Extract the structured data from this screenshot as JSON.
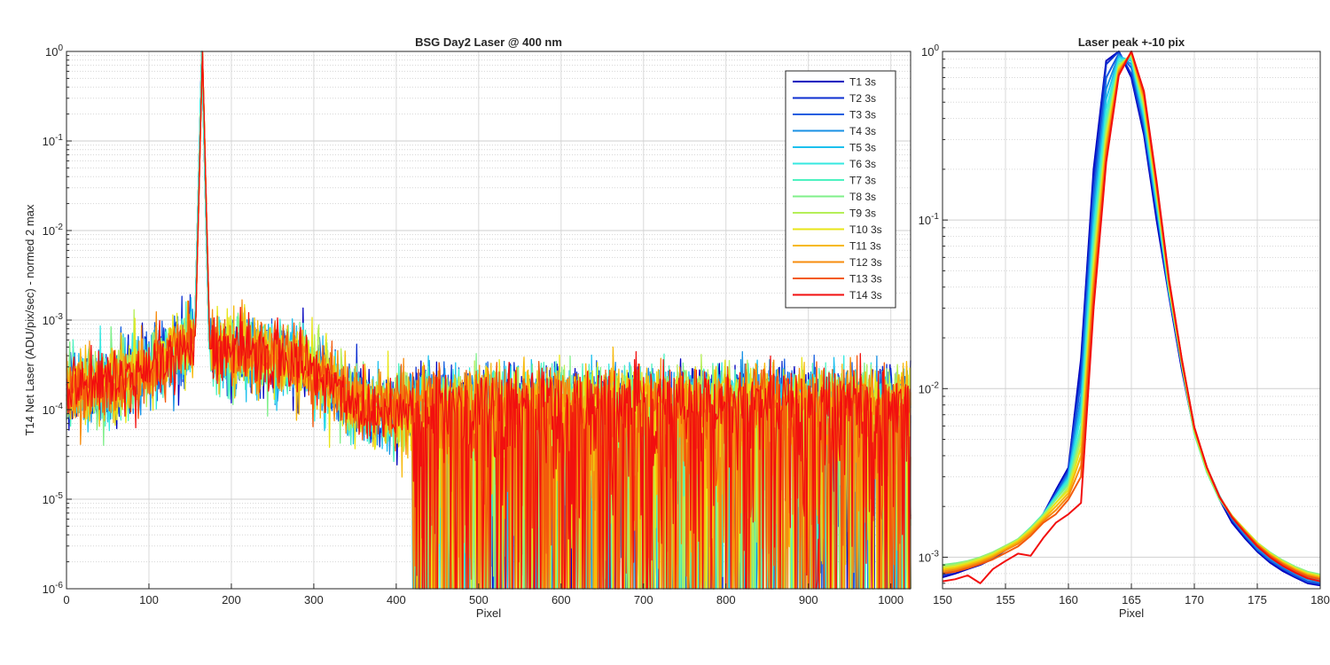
{
  "chart_data": [
    {
      "type": "line",
      "title": "BSG  Day2 Laser @ 400 nm",
      "xlabel": "Pixel",
      "ylabel": "T14 Net Laser (ADU/pix/sec) - normed 2 max",
      "yscale": "log",
      "xlim": [
        0,
        1024
      ],
      "ylim": [
        1e-06,
        1
      ],
      "xticks": [
        0,
        100,
        200,
        300,
        400,
        500,
        600,
        700,
        800,
        900,
        1000
      ],
      "yticks": [
        1e-06,
        1e-05,
        0.0001,
        0.001,
        0.01,
        0.1,
        1
      ],
      "grid": true,
      "legend_position": "top-right",
      "peak_pixel": 165,
      "spike": {
        "series": "T11 3s",
        "x": 663,
        "y": 0.0005
      },
      "series": [
        {
          "name": "T1 3s",
          "color": "#0000bf",
          "peak_x": 164
        },
        {
          "name": "T2 3s",
          "color": "#0c2fd0",
          "peak_x": 164
        },
        {
          "name": "T3 3s",
          "color": "#165ee0",
          "peak_x": 164
        },
        {
          "name": "T4 3s",
          "color": "#1891e4",
          "peak_x": 164
        },
        {
          "name": "T5 3s",
          "color": "#1cc0ee",
          "peak_x": 164
        },
        {
          "name": "T6 3s",
          "color": "#35e8e0",
          "peak_x": 164
        },
        {
          "name": "T7 3s",
          "color": "#4df2c0",
          "peak_x": 164
        },
        {
          "name": "T8 3s",
          "color": "#7ff08a",
          "peak_x": 165
        },
        {
          "name": "T9 3s",
          "color": "#b5ef58",
          "peak_x": 165
        },
        {
          "name": "T10 3s",
          "color": "#e8e618",
          "peak_x": 165
        },
        {
          "name": "T11 3s",
          "color": "#f7b90a",
          "peak_x": 165
        },
        {
          "name": "T12 3s",
          "color": "#f78c0e",
          "peak_x": 165
        },
        {
          "name": "T13 3s",
          "color": "#f35a0c",
          "peak_x": 165
        },
        {
          "name": "T14 3s",
          "color": "#f20f0f",
          "peak_x": 165
        }
      ]
    },
    {
      "type": "line",
      "title": "Laser peak +-10 pix",
      "xlabel": "Pixel",
      "ylabel": "",
      "yscale": "log",
      "xlim": [
        150,
        180
      ],
      "ylim": [
        0.00065,
        1
      ],
      "xticks": [
        150,
        155,
        160,
        165,
        170,
        175,
        180
      ],
      "yticks": [
        0.001,
        0.01,
        0.1,
        1
      ],
      "grid": true,
      "x": [
        150,
        151,
        152,
        153,
        154,
        155,
        156,
        157,
        158,
        159,
        160,
        161,
        162,
        163,
        164,
        165,
        166,
        167,
        168,
        169,
        170,
        171,
        172,
        173,
        174,
        175,
        176,
        177,
        178,
        179,
        180
      ],
      "series": [
        {
          "name": "T1 3s",
          "values": [
            0.00076,
            0.0008,
            0.00085,
            0.0009,
            0.00098,
            0.0011,
            0.00122,
            0.00145,
            0.0018,
            0.0025,
            0.0034,
            0.015,
            0.2,
            0.88,
            1.0,
            0.7,
            0.32,
            0.1,
            0.035,
            0.013,
            0.0055,
            0.0033,
            0.0022,
            0.0016,
            0.0013,
            0.00108,
            0.00093,
            0.00083,
            0.00076,
            0.0007,
            0.00068
          ]
        },
        {
          "name": "T2 3s",
          "values": [
            0.00078,
            0.00082,
            0.00086,
            0.00091,
            0.00099,
            0.00111,
            0.00123,
            0.00146,
            0.0018,
            0.0024,
            0.0033,
            0.013,
            0.17,
            0.84,
            1.0,
            0.73,
            0.34,
            0.11,
            0.036,
            0.014,
            0.0057,
            0.0034,
            0.0023,
            0.00165,
            0.00133,
            0.0011,
            0.00095,
            0.00085,
            0.00077,
            0.00071,
            0.00069
          ]
        },
        {
          "name": "T3 3s",
          "values": [
            0.0008,
            0.00083,
            0.00087,
            0.00092,
            0.001,
            0.00112,
            0.00124,
            0.00147,
            0.0018,
            0.0024,
            0.0032,
            0.011,
            0.14,
            0.7,
            0.97,
            0.8,
            0.36,
            0.115,
            0.037,
            0.0145,
            0.0058,
            0.0034,
            0.0023,
            0.00168,
            0.00135,
            0.00111,
            0.00096,
            0.00086,
            0.00078,
            0.00072,
            0.0007
          ]
        },
        {
          "name": "T4 3s",
          "values": [
            0.00082,
            0.00085,
            0.00088,
            0.00093,
            0.00101,
            0.00113,
            0.00125,
            0.00148,
            0.0018,
            0.0023,
            0.0031,
            0.009,
            0.12,
            0.6,
            0.95,
            0.84,
            0.38,
            0.12,
            0.037,
            0.0145,
            0.0058,
            0.0034,
            0.0023,
            0.0017,
            0.00137,
            0.00113,
            0.00098,
            0.00088,
            0.0008,
            0.00074,
            0.00071
          ]
        },
        {
          "name": "T5 3s",
          "values": [
            0.00084,
            0.00087,
            0.0009,
            0.00095,
            0.00103,
            0.00114,
            0.00126,
            0.00149,
            0.0018,
            0.0023,
            0.003,
            0.008,
            0.1,
            0.52,
            0.93,
            0.88,
            0.4,
            0.125,
            0.037,
            0.0142,
            0.0056,
            0.0033,
            0.0023,
            0.00172,
            0.0014,
            0.00116,
            0.00101,
            0.0009,
            0.00082,
            0.00076,
            0.00073
          ]
        },
        {
          "name": "T6 3s",
          "values": [
            0.00086,
            0.00089,
            0.00092,
            0.00097,
            0.00105,
            0.00115,
            0.00127,
            0.0015,
            0.0018,
            0.0023,
            0.0029,
            0.007,
            0.085,
            0.45,
            0.9,
            0.9,
            0.42,
            0.13,
            0.038,
            0.014,
            0.0055,
            0.0032,
            0.0022,
            0.00172,
            0.00142,
            0.00118,
            0.00103,
            0.00092,
            0.00084,
            0.00078,
            0.00075
          ]
        },
        {
          "name": "T7 3s",
          "values": [
            0.00088,
            0.0009,
            0.00093,
            0.00098,
            0.00106,
            0.00116,
            0.00128,
            0.0015,
            0.0018,
            0.0022,
            0.0028,
            0.006,
            0.075,
            0.4,
            0.87,
            0.92,
            0.44,
            0.135,
            0.038,
            0.0138,
            0.0054,
            0.0032,
            0.0022,
            0.00173,
            0.00144,
            0.0012,
            0.00105,
            0.00094,
            0.00086,
            0.0008,
            0.00077
          ]
        },
        {
          "name": "T8 3s",
          "values": [
            0.0009,
            0.00092,
            0.00095,
            0.001,
            0.00107,
            0.00117,
            0.00128,
            0.00149,
            0.00178,
            0.0022,
            0.0027,
            0.0055,
            0.065,
            0.36,
            0.84,
            0.94,
            0.46,
            0.14,
            0.039,
            0.014,
            0.0055,
            0.0032,
            0.0022,
            0.00175,
            0.00146,
            0.00122,
            0.00107,
            0.00096,
            0.00088,
            0.00082,
            0.00079
          ]
        },
        {
          "name": "T9 3s",
          "values": [
            0.00088,
            0.0009,
            0.00094,
            0.00099,
            0.00106,
            0.00116,
            0.00127,
            0.00147,
            0.00175,
            0.0021,
            0.0026,
            0.005,
            0.058,
            0.33,
            0.82,
            0.96,
            0.48,
            0.145,
            0.04,
            0.0142,
            0.0056,
            0.0033,
            0.00225,
            0.00176,
            0.00146,
            0.00122,
            0.00106,
            0.00095,
            0.00087,
            0.00081,
            0.00078
          ]
        },
        {
          "name": "T10 3s",
          "values": [
            0.00086,
            0.00088,
            0.00092,
            0.00097,
            0.00104,
            0.00114,
            0.00125,
            0.00145,
            0.00172,
            0.0021,
            0.0025,
            0.0045,
            0.05,
            0.3,
            0.8,
            0.97,
            0.5,
            0.15,
            0.041,
            0.0145,
            0.0057,
            0.0033,
            0.00226,
            0.00175,
            0.00145,
            0.00121,
            0.00105,
            0.00094,
            0.00086,
            0.0008,
            0.00077
          ]
        },
        {
          "name": "T11 3s",
          "values": [
            0.00084,
            0.00086,
            0.0009,
            0.00095,
            0.00102,
            0.00112,
            0.00123,
            0.00142,
            0.00168,
            0.002,
            0.0024,
            0.004,
            0.045,
            0.28,
            0.78,
            0.98,
            0.52,
            0.155,
            0.042,
            0.0148,
            0.0058,
            0.0034,
            0.00228,
            0.00175,
            0.00144,
            0.0012,
            0.00104,
            0.00093,
            0.00085,
            0.00079,
            0.00076
          ]
        },
        {
          "name": "T12 3s",
          "values": [
            0.00082,
            0.00084,
            0.00088,
            0.00093,
            0.001,
            0.0011,
            0.0012,
            0.00138,
            0.00164,
            0.0019,
            0.0023,
            0.0035,
            0.04,
            0.26,
            0.76,
            0.99,
            0.54,
            0.16,
            0.042,
            0.0148,
            0.0058,
            0.0034,
            0.00228,
            0.00174,
            0.00143,
            0.00119,
            0.00103,
            0.00092,
            0.00084,
            0.00078,
            0.00075
          ]
        },
        {
          "name": "T13 3s",
          "values": [
            0.0008,
            0.00082,
            0.00086,
            0.00091,
            0.00097,
            0.00106,
            0.00116,
            0.00134,
            0.0016,
            0.0018,
            0.0022,
            0.003,
            0.035,
            0.24,
            0.74,
            1.0,
            0.56,
            0.165,
            0.043,
            0.015,
            0.0059,
            0.0034,
            0.00228,
            0.00173,
            0.00142,
            0.00118,
            0.00102,
            0.00091,
            0.00083,
            0.00077,
            0.00074
          ]
        },
        {
          "name": "T14 3s",
          "values": [
            0.00072,
            0.00074,
            0.00078,
            0.0007,
            0.00085,
            0.00095,
            0.00105,
            0.00102,
            0.0013,
            0.0016,
            0.0018,
            0.0021,
            0.03,
            0.22,
            0.72,
            1.0,
            0.58,
            0.17,
            0.044,
            0.015,
            0.0059,
            0.0034,
            0.00227,
            0.00172,
            0.0014,
            0.00116,
            0.001,
            0.00089,
            0.00081,
            0.00075,
            0.00072
          ]
        }
      ]
    }
  ]
}
